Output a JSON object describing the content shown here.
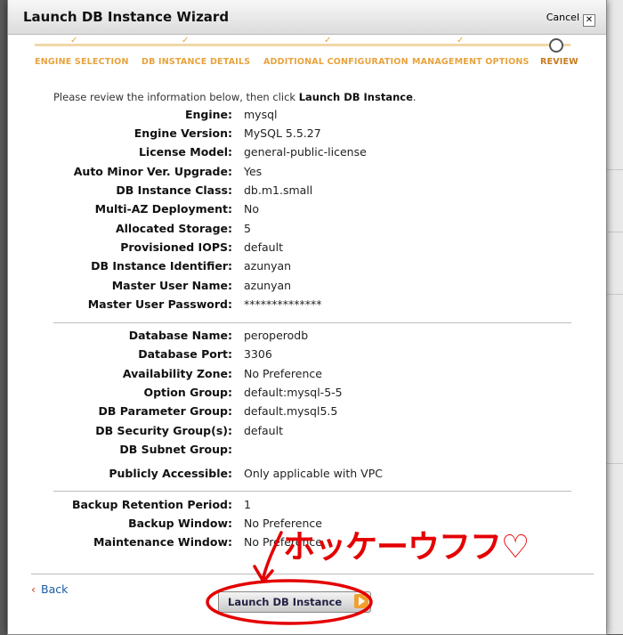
{
  "dialog": {
    "title": "Launch DB Instance Wizard",
    "cancel_label": "Cancel",
    "close_glyph": "✕"
  },
  "steps": [
    {
      "label": "ENGINE SELECTION",
      "state": "done"
    },
    {
      "label": "DB INSTANCE DETAILS",
      "state": "done"
    },
    {
      "label": "ADDITIONAL CONFIGURATION",
      "state": "done"
    },
    {
      "label": "MANAGEMENT OPTIONS",
      "state": "done"
    },
    {
      "label": "REVIEW",
      "state": "current"
    }
  ],
  "step_tick": "✓",
  "intro": {
    "prefix": "Please review the information below, then click ",
    "action": "Launch DB Instance",
    "suffix": "."
  },
  "section1": [
    {
      "label": "Engine:",
      "value": "mysql"
    },
    {
      "label": "Engine Version:",
      "value": "MySQL 5.5.27"
    },
    {
      "label": "License Model:",
      "value": "general-public-license"
    },
    {
      "label": "Auto Minor Ver. Upgrade:",
      "value": "Yes"
    },
    {
      "label": "DB Instance Class:",
      "value": "db.m1.small"
    },
    {
      "label": "Multi-AZ Deployment:",
      "value": "No"
    },
    {
      "label": "Allocated Storage:",
      "value": "5"
    },
    {
      "label": "Provisioned IOPS:",
      "value": "default"
    },
    {
      "label": "DB Instance Identifier:",
      "value": "azunyan"
    },
    {
      "label": "Master User Name:",
      "value": "azunyan"
    },
    {
      "label": "Master User Password:",
      "value": "**************"
    }
  ],
  "section2": [
    {
      "label": "Database Name:",
      "value": "peroperodb"
    },
    {
      "label": "Database Port:",
      "value": "3306"
    },
    {
      "label": "Availability Zone:",
      "value": "No Preference"
    },
    {
      "label": "Option Group:",
      "value": "default:mysql-5-5"
    },
    {
      "label": "DB Parameter Group:",
      "value": "default.mysql5.5"
    },
    {
      "label": "DB Security Group(s):",
      "value": "default"
    },
    {
      "label": "DB Subnet Group:",
      "value": ""
    },
    {
      "label": "Publicly Accessible:",
      "value": "Only applicable with VPC"
    }
  ],
  "section3": [
    {
      "label": "Backup Retention Period:",
      "value": "1"
    },
    {
      "label": "Backup Window:",
      "value": "No Preference"
    },
    {
      "label": "Maintenance Window:",
      "value": "No Preference"
    }
  ],
  "footer": {
    "back_label": "Back",
    "back_glyph": "‹",
    "launch_label": "Launch DB Instance"
  },
  "annotation": {
    "text": "ホッケーウフフ♡",
    "color": "#e40000"
  }
}
